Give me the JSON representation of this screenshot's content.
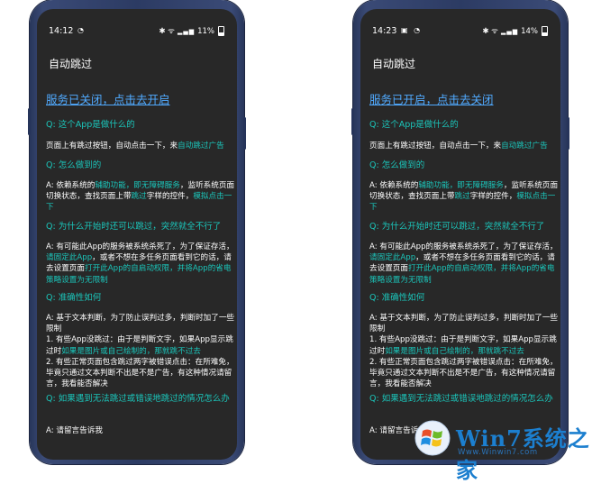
{
  "screens": [
    {
      "status_time": "14:12",
      "status_left_icons": "◔",
      "status_right_icons": "✱ ᯤ",
      "battery": "11%",
      "app_title": "自动跳过",
      "service_status": "服务已关闭，点击去开启",
      "q1": "Q: 这个App是做什么的",
      "a1": [
        "页面上有跳过按钮，自动点击一下，来",
        "自动跳过广告"
      ],
      "q2": "Q: 怎么做到的",
      "a2": [
        "A: 依赖系统的",
        "辅助功能，即无障碍服务",
        "，监听系统页面切换状态，查找页面上带",
        "跳过",
        "字样的控件，",
        "模拟点击一下"
      ],
      "q3": "Q: 为什么开始时还可以跳过，突然就全不行了",
      "a3": [
        "A: 有可能此App的服务被系统杀死了，为了保证存活，",
        "请固定此App",
        "，或者不想在多任务页面看到它的话，请去设置页面",
        "打开此App的自启动权限，并将App的省电策略设置为无限制"
      ],
      "q4": "Q: 准确性如何",
      "a4": [
        "A: 基于文本判断，为了防止误判过多，判断时加了一些限制",
        "1. 有些App没跳过：由于是判断文字，如果App显示跳过时",
        "如果是图片或自己绘制的，那就跳不过去",
        "2. 有些正常页面包含跳过两字被错误点击：在所难免，毕竟只通过文本判断不出是不是广告，有这种情况请留言，我看能否解决"
      ],
      "q5": "Q: 如果遇到无法跳过或错误地跳过的情况怎么办",
      "a5": "A: 请留言告诉我"
    },
    {
      "status_time": "14:23",
      "status_left_icons": "▣ ◔",
      "status_right_icons": "✱ ᯤ",
      "battery": "14%",
      "app_title": "自动跳过",
      "service_status": "服务已开启，点击去关闭",
      "q1": "Q: 这个App是做什么的",
      "a1": [
        "页面上有跳过按钮，自动点击一下，来",
        "自动跳过广告"
      ],
      "q2": "Q: 怎么做到的",
      "a2": [
        "A: 依赖系统的",
        "辅助功能，即无障碍服务",
        "，监听系统页面切换状态，查找页面上带",
        "跳过",
        "字样的控件，",
        "模拟点击一下"
      ],
      "q3": "Q: 为什么开始时还可以跳过，突然就全不行了",
      "a3": [
        "A: 有可能此App的服务被系统杀死了，为了保证存活，",
        "请固定此App",
        "，或者不想在多任务页面看到它的话，请去设置页面",
        "打开此App的自启动权限，并将App的省电策略设置为无限制"
      ],
      "q4": "Q: 准确性如何",
      "a4": [
        "A: 基于文本判断，为了防止误判过多，判断时加了一些限制",
        "1. 有些App没跳过：由于是判断文字，如果App显示跳过时",
        "如果是图片或自己绘制的，那就跳不过去",
        "2. 有些正常页面包含跳过两字被错误点击：在所难免，毕竟只通过文本判断不出是不是广告，有这种情况请留言，我看能否解决"
      ],
      "q5": "Q: 如果遇到无法跳过或错误地跳过的情况怎么办",
      "a5": "A: 请留言告诉我"
    }
  ],
  "watermark": {
    "brand": "Win7系统之家",
    "url": "Www.Winwin7.com"
  },
  "colors": {
    "screen_bg": "#282828",
    "link_blue": "#50aaff",
    "accent_teal": "#1bc6bb",
    "text_white": "#ffffff",
    "phone_frame": "#2c3b63"
  }
}
